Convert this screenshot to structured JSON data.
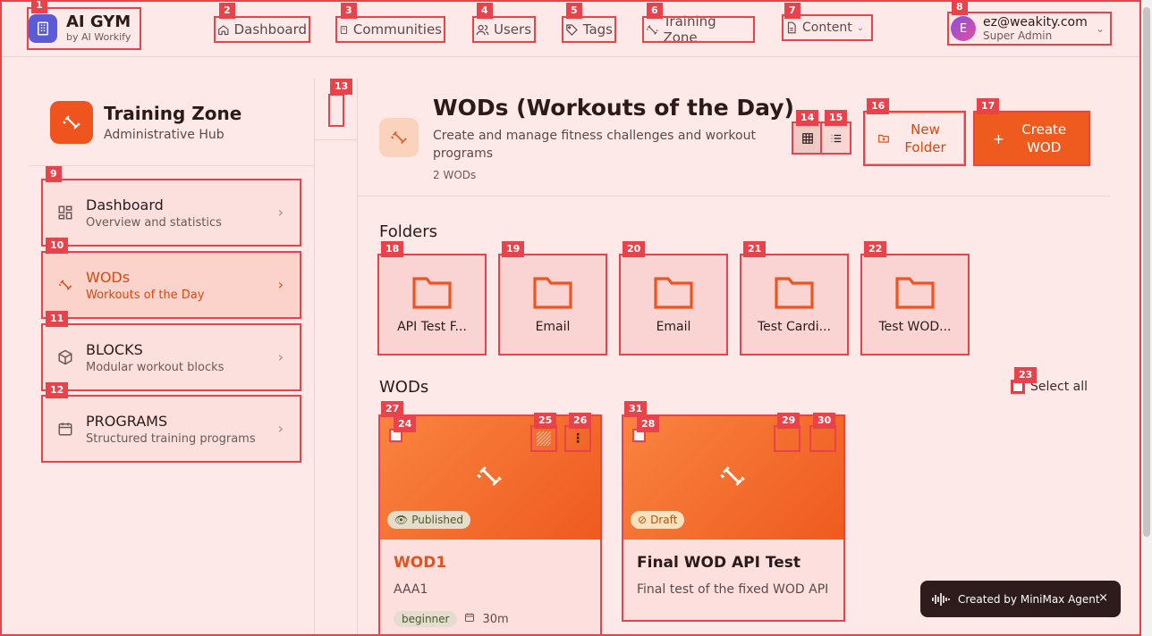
{
  "app": {
    "name": "AI GYM",
    "by": "by AI Workify"
  },
  "nav": {
    "dashboard": "Dashboard",
    "communities": "Communities",
    "users": "Users",
    "tags": "Tags",
    "training_zone": "Training Zone",
    "content": "Content"
  },
  "user": {
    "initial": "E",
    "email": "ez@weakity.com",
    "role": "Super Admin"
  },
  "sidebar": {
    "title": "Training Zone",
    "subtitle": "Administrative Hub",
    "items": [
      {
        "label": "Dashboard",
        "sub": "Overview and statistics"
      },
      {
        "label": "WODs",
        "sub": "Workouts of the Day"
      },
      {
        "label": "BLOCKS",
        "sub": "Modular workout blocks"
      },
      {
        "label": "PROGRAMS",
        "sub": "Structured training programs"
      }
    ]
  },
  "page": {
    "title": "WODs (Workouts of the Day)",
    "description": "Create and manage fitness challenges and workout programs",
    "count": "2 WODs",
    "new_folder": "New Folder",
    "create": "Create WOD"
  },
  "folders": {
    "heading": "Folders",
    "items": [
      "API Test F...",
      "Email",
      "Email",
      "Test Cardi...",
      "Test WOD..."
    ]
  },
  "wods": {
    "heading": "WODs",
    "select_all": "Select all",
    "cards": [
      {
        "status": "Published",
        "title": "WOD1",
        "desc": "AAA1",
        "level": "beginner",
        "duration": "30m"
      },
      {
        "status": "Draft",
        "title": "Final WOD API Test",
        "desc": "Final test of the fixed WOD API"
      }
    ]
  },
  "toast": {
    "text": "Created by MiniMax Agent",
    "close": "×"
  },
  "labels": {
    "l1": "1",
    "l2": "2",
    "l3": "3",
    "l4": "4",
    "l5": "5",
    "l6": "6",
    "l7": "7",
    "l8": "8",
    "l9": "9",
    "l10": "10",
    "l11": "11",
    "l12": "12",
    "l13": "13",
    "l14": "14",
    "l15": "15",
    "l16": "16",
    "l17": "17",
    "l18": "18",
    "l19": "19",
    "l20": "20",
    "l21": "21",
    "l22": "22",
    "l23": "23",
    "l24": "24",
    "l25": "25",
    "l26": "26",
    "l27": "27",
    "l28": "28",
    "l29": "29",
    "l30": "30",
    "l31": "31"
  },
  "colors": {
    "accent": "#ef5a1f",
    "badge": "#e8434a",
    "background": "#fde9e7"
  }
}
